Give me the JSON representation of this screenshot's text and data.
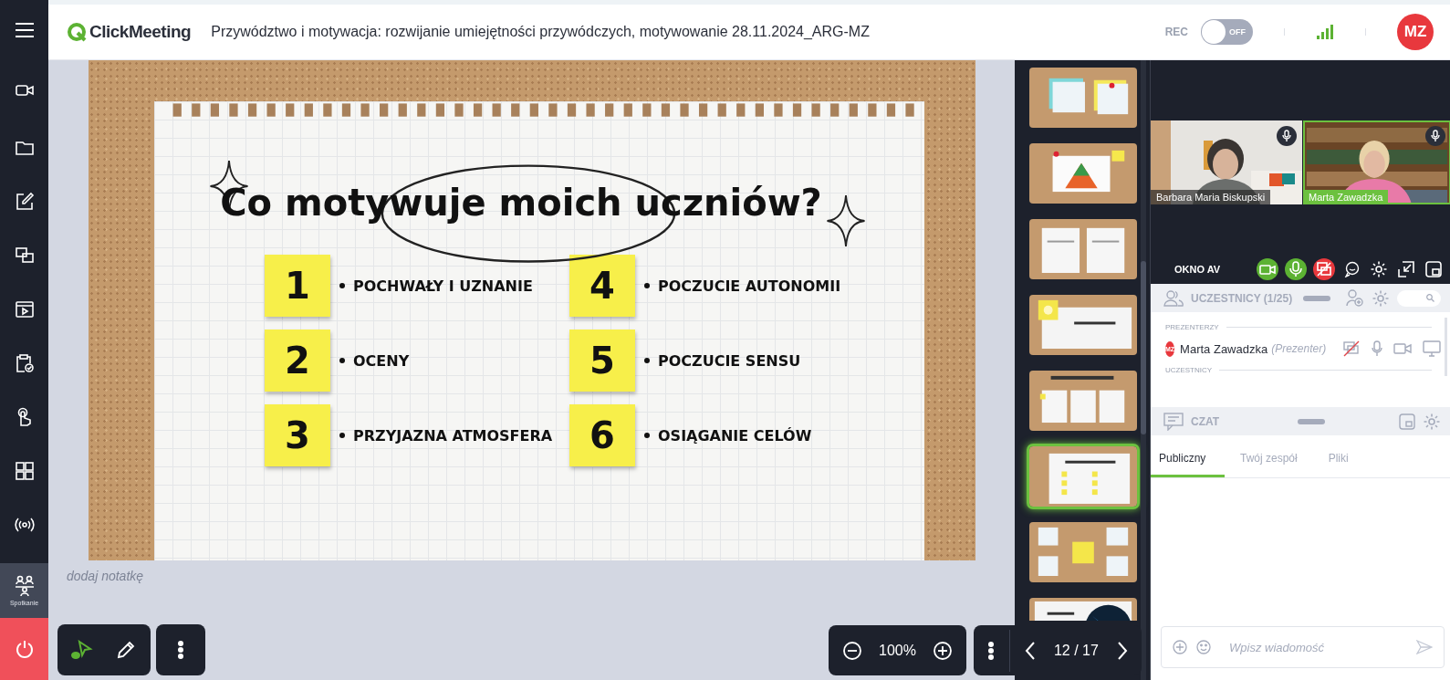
{
  "sidebar": {
    "items": [
      {
        "selected": false
      },
      {
        "selected": false
      },
      {
        "selected": false
      },
      {
        "selected": false
      },
      {
        "selected": false
      },
      {
        "selected": false
      },
      {
        "selected": false
      },
      {
        "selected": false
      },
      {
        "selected": false
      },
      {
        "label": "Spotkanie",
        "selected": true
      }
    ]
  },
  "header": {
    "logo": "ClickMeeting",
    "title": "Przywództwo i motywacja: rozwijanie umiejętności przywódczych, motywowanie 28.11.2024_ARG-MZ",
    "rec_label": "REC",
    "rec_toggle": {
      "label": "OFF",
      "on": false
    },
    "avatar": "MZ"
  },
  "slide": {
    "title": "Co motywuje moich uczniów?",
    "items": [
      {
        "number": "1",
        "text": "POCHWAŁY I UZNANIE"
      },
      {
        "number": "4",
        "text": "POCZUCIE AUTONOMII"
      },
      {
        "number": "2",
        "text": "OCENY"
      },
      {
        "number": "5",
        "text": "POCZUCIE SENSU"
      },
      {
        "number": "3",
        "text": "PRZYJAZNA ATMOSFERA"
      },
      {
        "number": "6",
        "text": "OSIĄGANIE CELÓW"
      }
    ]
  },
  "notes": {
    "placeholder": "dodaj notatkę"
  },
  "tools": [
    {
      "kind": "pointer",
      "selected": true
    },
    {
      "kind": "pen",
      "selected": false
    }
  ],
  "zoom": "100%",
  "pager": "12 / 17",
  "thumbnails": [
    {
      "selected": false
    },
    {
      "selected": false
    },
    {
      "selected": false
    },
    {
      "selected": false
    },
    {
      "selected": false
    },
    {
      "selected": true
    },
    {
      "selected": false
    },
    {
      "selected": false
    }
  ],
  "videos": [
    {
      "name": "Barbara Maria Biskupski",
      "active": false
    },
    {
      "name": "Marta Zawadzka",
      "active": true
    }
  ],
  "av_panel": {
    "title": "OKNO AV",
    "controls": [
      {
        "kind": "camera",
        "on": true
      },
      {
        "kind": "mic",
        "on": true
      },
      {
        "kind": "screen",
        "on": false
      }
    ]
  },
  "participants": {
    "title": "UCZESTNICY (1/25)",
    "groups": [
      {
        "label": "PREZENTERZY",
        "people": [
          {
            "initials": "MZ",
            "name": "Marta Zawadzka",
            "role": "(Prezenter)"
          }
        ]
      },
      {
        "label": "UCZESTNICY"
      }
    ]
  },
  "chat": {
    "title": "CZAT",
    "tabs": [
      {
        "label": "Publiczny",
        "selected": true
      },
      {
        "label": "Twój zespół",
        "selected": false
      },
      {
        "label": "Pliki",
        "selected": false
      }
    ],
    "placeholder": "Wpisz wiadomość"
  }
}
